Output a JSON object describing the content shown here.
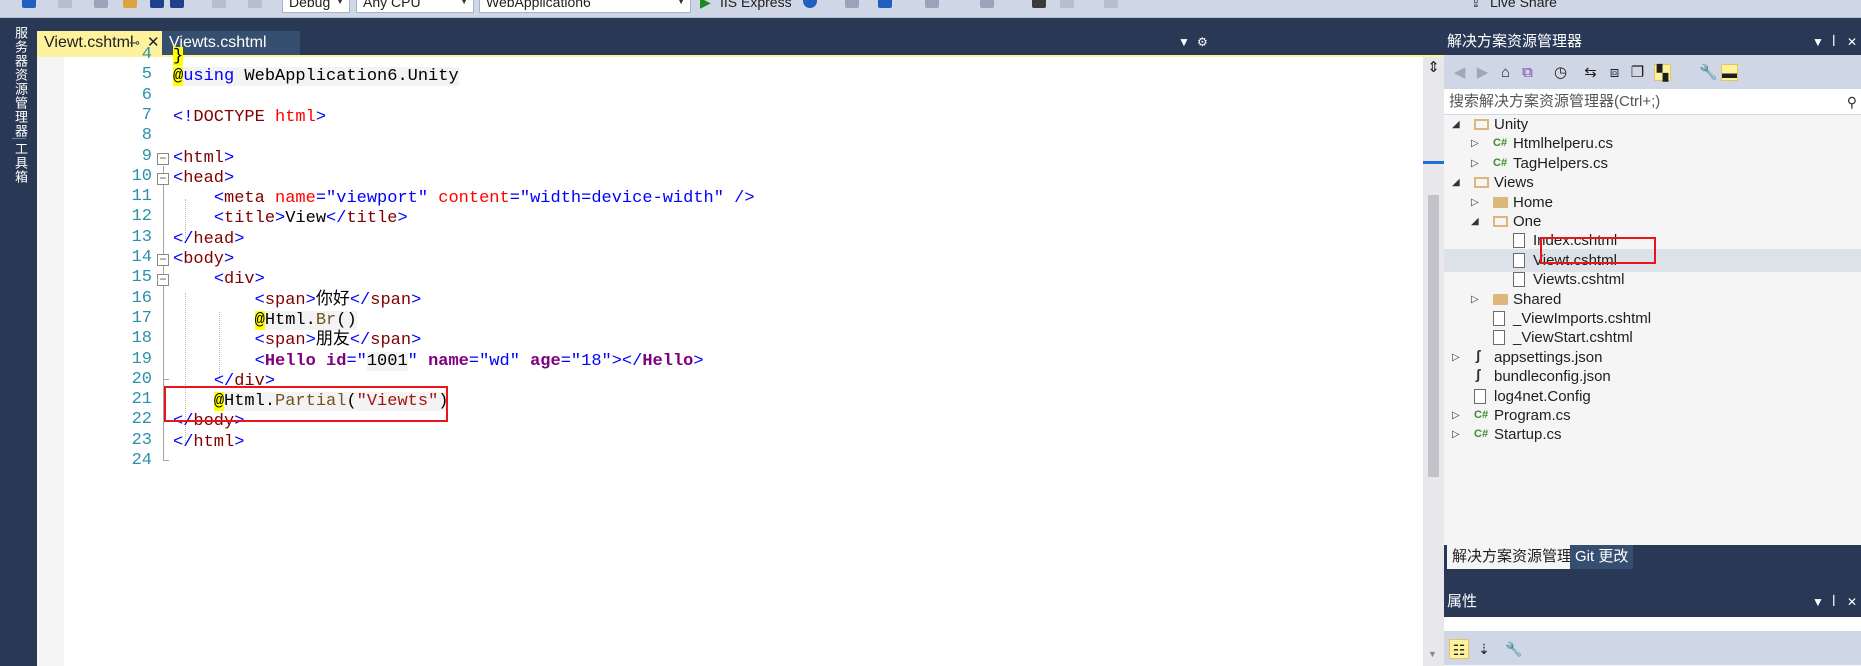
{
  "toolbar": {
    "config": "Debug",
    "platform": "Any CPU",
    "startup_project": "WebApplication6",
    "run_target": "IIS Express",
    "live_share": "Live Share"
  },
  "rail": {
    "tab1": "服务器资源管理器",
    "tab2": "工具箱"
  },
  "tabs": [
    {
      "label": "Viewt.cshtml",
      "active": true,
      "pinned": true
    },
    {
      "label": "Viewts.cshtml",
      "active": false
    }
  ],
  "editor": {
    "lines": [
      {
        "n": "4",
        "segs": [
          {
            "t": "}",
            "c": "k-at"
          }
        ]
      },
      {
        "n": "5",
        "segs": [
          {
            "t": "@",
            "c": "k-at"
          },
          {
            "t": "using",
            "c": "k-kw k-razorbg"
          },
          {
            "t": " WebApplication6.Unity",
            "c": "k-txt k-razorbg"
          }
        ]
      },
      {
        "n": "6",
        "segs": []
      },
      {
        "n": "7",
        "segs": [
          {
            "t": "<!",
            "c": "k-brk"
          },
          {
            "t": "DOCTYPE",
            "c": "k-tag"
          },
          {
            "t": " ",
            "c": "k-txt"
          },
          {
            "t": "html",
            "c": "k-attr"
          },
          {
            "t": ">",
            "c": "k-brk"
          }
        ]
      },
      {
        "n": "8",
        "segs": []
      },
      {
        "n": "9",
        "segs": [
          {
            "t": "<",
            "c": "k-brk"
          },
          {
            "t": "html",
            "c": "k-tag"
          },
          {
            "t": ">",
            "c": "k-brk"
          }
        ]
      },
      {
        "n": "10",
        "segs": [
          {
            "t": "<",
            "c": "k-brk"
          },
          {
            "t": "head",
            "c": "k-tag"
          },
          {
            "t": ">",
            "c": "k-brk"
          }
        ]
      },
      {
        "n": "11",
        "segs": [
          {
            "t": "    ",
            "c": "k-txt"
          },
          {
            "t": "<",
            "c": "k-brk"
          },
          {
            "t": "meta",
            "c": "k-tag"
          },
          {
            "t": " ",
            "c": "k-txt"
          },
          {
            "t": "name",
            "c": "k-attr"
          },
          {
            "t": "=",
            "c": "k-brk"
          },
          {
            "t": "\"viewport\"",
            "c": "k-val"
          },
          {
            "t": " ",
            "c": "k-txt"
          },
          {
            "t": "content",
            "c": "k-attr"
          },
          {
            "t": "=",
            "c": "k-brk"
          },
          {
            "t": "\"width=device-width\"",
            "c": "k-val"
          },
          {
            "t": " />",
            "c": "k-brk"
          }
        ]
      },
      {
        "n": "12",
        "segs": [
          {
            "t": "    ",
            "c": "k-txt"
          },
          {
            "t": "<",
            "c": "k-brk"
          },
          {
            "t": "title",
            "c": "k-tag"
          },
          {
            "t": ">",
            "c": "k-brk"
          },
          {
            "t": "View",
            "c": "k-txt"
          },
          {
            "t": "</",
            "c": "k-brk"
          },
          {
            "t": "title",
            "c": "k-tag"
          },
          {
            "t": ">",
            "c": "k-brk"
          }
        ]
      },
      {
        "n": "13",
        "segs": [
          {
            "t": "</",
            "c": "k-brk"
          },
          {
            "t": "head",
            "c": "k-tag"
          },
          {
            "t": ">",
            "c": "k-brk"
          }
        ]
      },
      {
        "n": "14",
        "segs": [
          {
            "t": "<",
            "c": "k-brk"
          },
          {
            "t": "body",
            "c": "k-tag"
          },
          {
            "t": ">",
            "c": "k-brk"
          }
        ]
      },
      {
        "n": "15",
        "segs": [
          {
            "t": "    ",
            "c": "k-txt"
          },
          {
            "t": "<",
            "c": "k-brk"
          },
          {
            "t": "div",
            "c": "k-tag"
          },
          {
            "t": ">",
            "c": "k-brk"
          }
        ]
      },
      {
        "n": "16",
        "segs": [
          {
            "t": "        ",
            "c": "k-txt"
          },
          {
            "t": "<",
            "c": "k-brk"
          },
          {
            "t": "span",
            "c": "k-tag"
          },
          {
            "t": ">",
            "c": "k-brk"
          },
          {
            "t": "你好",
            "c": "k-txt"
          },
          {
            "t": "</",
            "c": "k-brk"
          },
          {
            "t": "span",
            "c": "k-tag"
          },
          {
            "t": ">",
            "c": "k-brk"
          }
        ]
      },
      {
        "n": "17",
        "segs": [
          {
            "t": "        ",
            "c": "k-txt"
          },
          {
            "t": "@",
            "c": "k-at"
          },
          {
            "t": "Html.",
            "c": "k-txt k-razorbg"
          },
          {
            "t": "Br",
            "c": "k-method k-razorbg"
          },
          {
            "t": "()",
            "c": "k-txt k-razorbg"
          }
        ]
      },
      {
        "n": "18",
        "segs": [
          {
            "t": "        ",
            "c": "k-txt"
          },
          {
            "t": "<",
            "c": "k-brk"
          },
          {
            "t": "span",
            "c": "k-tag"
          },
          {
            "t": ">",
            "c": "k-brk"
          },
          {
            "t": "朋友",
            "c": "k-txt"
          },
          {
            "t": "</",
            "c": "k-brk"
          },
          {
            "t": "span",
            "c": "k-tag"
          },
          {
            "t": ">",
            "c": "k-brk"
          }
        ]
      },
      {
        "n": "19",
        "segs": [
          {
            "t": "        ",
            "c": "k-txt"
          },
          {
            "t": "<",
            "c": "k-brk"
          },
          {
            "t": "Hello",
            "c": "k-purple k-bold"
          },
          {
            "t": " ",
            "c": "k-txt"
          },
          {
            "t": "id",
            "c": "k-purple k-bold"
          },
          {
            "t": "=\"",
            "c": "k-brk"
          },
          {
            "t": "1001",
            "c": "k-num k-razorbg"
          },
          {
            "t": "\"",
            "c": "k-brk"
          },
          {
            "t": " ",
            "c": "k-txt"
          },
          {
            "t": "name",
            "c": "k-purple k-bold"
          },
          {
            "t": "=",
            "c": "k-brk"
          },
          {
            "t": "\"wd\"",
            "c": "k-val"
          },
          {
            "t": " ",
            "c": "k-txt"
          },
          {
            "t": "age",
            "c": "k-purple k-bold"
          },
          {
            "t": "=",
            "c": "k-brk"
          },
          {
            "t": "\"18\"",
            "c": "k-val"
          },
          {
            "t": "></",
            "c": "k-brk"
          },
          {
            "t": "Hello",
            "c": "k-purple k-bold"
          },
          {
            "t": ">",
            "c": "k-brk"
          }
        ]
      },
      {
        "n": "20",
        "segs": [
          {
            "t": "    ",
            "c": "k-txt"
          },
          {
            "t": "</",
            "c": "k-brk"
          },
          {
            "t": "div",
            "c": "k-tag"
          },
          {
            "t": ">",
            "c": "k-brk"
          }
        ]
      },
      {
        "n": "21",
        "segs": [
          {
            "t": "    ",
            "c": "k-txt"
          },
          {
            "t": "@",
            "c": "k-at"
          },
          {
            "t": "Html.",
            "c": "k-txt k-razorbg"
          },
          {
            "t": "Partial",
            "c": "k-method k-razorbg"
          },
          {
            "t": "(",
            "c": "k-txt k-razorbg"
          },
          {
            "t": "\"Viewts\"",
            "c": "k-str k-razorbg"
          },
          {
            "t": ")",
            "c": "k-txt k-razorbg"
          }
        ]
      },
      {
        "n": "22",
        "segs": [
          {
            "t": "</",
            "c": "k-brk"
          },
          {
            "t": "body",
            "c": "k-tag"
          },
          {
            "t": ">",
            "c": "k-brk"
          }
        ]
      },
      {
        "n": "23",
        "segs": [
          {
            "t": "</",
            "c": "k-brk"
          },
          {
            "t": "html",
            "c": "k-tag"
          },
          {
            "t": ">",
            "c": "k-brk"
          }
        ]
      },
      {
        "n": "24",
        "segs": []
      }
    ]
  },
  "solution_explorer": {
    "title": "解决方案资源管理器",
    "search_placeholder": "搜索解决方案资源管理器(Ctrl+;)",
    "items": [
      {
        "label": "Unity",
        "icon": "folder-open",
        "depth": 1,
        "expander": "expanded"
      },
      {
        "label": "Htmlhelperu.cs",
        "icon": "csharp-file",
        "depth": 2,
        "expander": "collapsed"
      },
      {
        "label": "TagHelpers.cs",
        "icon": "csharp-file",
        "depth": 2,
        "expander": "collapsed"
      },
      {
        "label": "Views",
        "icon": "folder-open",
        "depth": 1,
        "expander": "expanded"
      },
      {
        "label": "Home",
        "icon": "folder",
        "depth": 2,
        "expander": "collapsed"
      },
      {
        "label": "One",
        "icon": "folder-open",
        "depth": 2,
        "expander": "expanded"
      },
      {
        "label": "Index.cshtml",
        "icon": "razor-file",
        "depth": 3,
        "expander": "none"
      },
      {
        "label": "Viewt.cshtml",
        "icon": "razor-file",
        "depth": 3,
        "expander": "none",
        "selected": true
      },
      {
        "label": "Viewts.cshtml",
        "icon": "razor-file",
        "depth": 3,
        "expander": "none"
      },
      {
        "label": "Shared",
        "icon": "folder",
        "depth": 2,
        "expander": "collapsed"
      },
      {
        "label": "_ViewImports.cshtml",
        "icon": "razor-file",
        "depth": 2,
        "expander": "none"
      },
      {
        "label": "_ViewStart.cshtml",
        "icon": "razor-file",
        "depth": 2,
        "expander": "none"
      },
      {
        "label": "appsettings.json",
        "icon": "json-file",
        "depth": 1,
        "expander": "collapsed"
      },
      {
        "label": "bundleconfig.json",
        "icon": "json-file",
        "depth": 1,
        "expander": "none"
      },
      {
        "label": "log4net.Config",
        "icon": "config-file",
        "depth": 1,
        "expander": "none"
      },
      {
        "label": "Program.cs",
        "icon": "csharp-file",
        "depth": 1,
        "expander": "collapsed"
      },
      {
        "label": "Startup.cs",
        "icon": "csharp-file",
        "depth": 1,
        "expander": "collapsed"
      }
    ],
    "bottom_tabs": [
      {
        "label": "解决方案资源管理器",
        "active": true
      },
      {
        "label": "Git 更改",
        "active": false
      }
    ]
  },
  "properties": {
    "title": "属性"
  },
  "colors": {
    "chrome": "#293955",
    "active_tab": "#fff29d",
    "highlight_box": "#e8161a",
    "line_number": "#2b91af"
  }
}
